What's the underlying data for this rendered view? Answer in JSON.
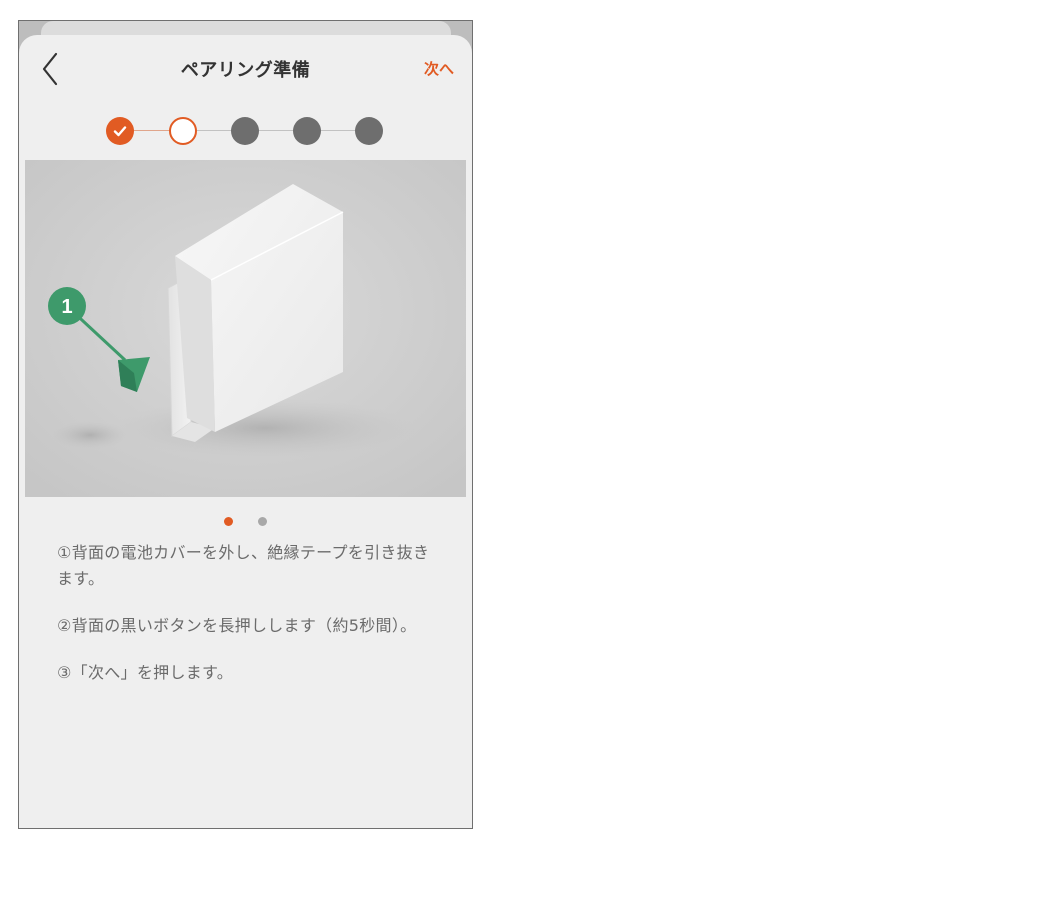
{
  "header": {
    "title": "ペアリング準備",
    "next_label": "次へ"
  },
  "stepper": {
    "steps": [
      "done",
      "current",
      "todo",
      "todo",
      "todo"
    ]
  },
  "illustration": {
    "callout_number": "1"
  },
  "carousel": {
    "page_count": 2,
    "active_index": 0
  },
  "instructions": [
    "①背面の電池カバーを外し、絶縁テープを引き抜きます。",
    "②背面の黒いボタンを長押しします（約5秒間）。",
    "③「次へ」を押します。"
  ],
  "colors": {
    "accent": "#e15b23",
    "step_inactive": "#6e6e6e",
    "callout_green": "#3e9a6b",
    "text_body": "#6b6b6b",
    "background": "#efefef"
  }
}
